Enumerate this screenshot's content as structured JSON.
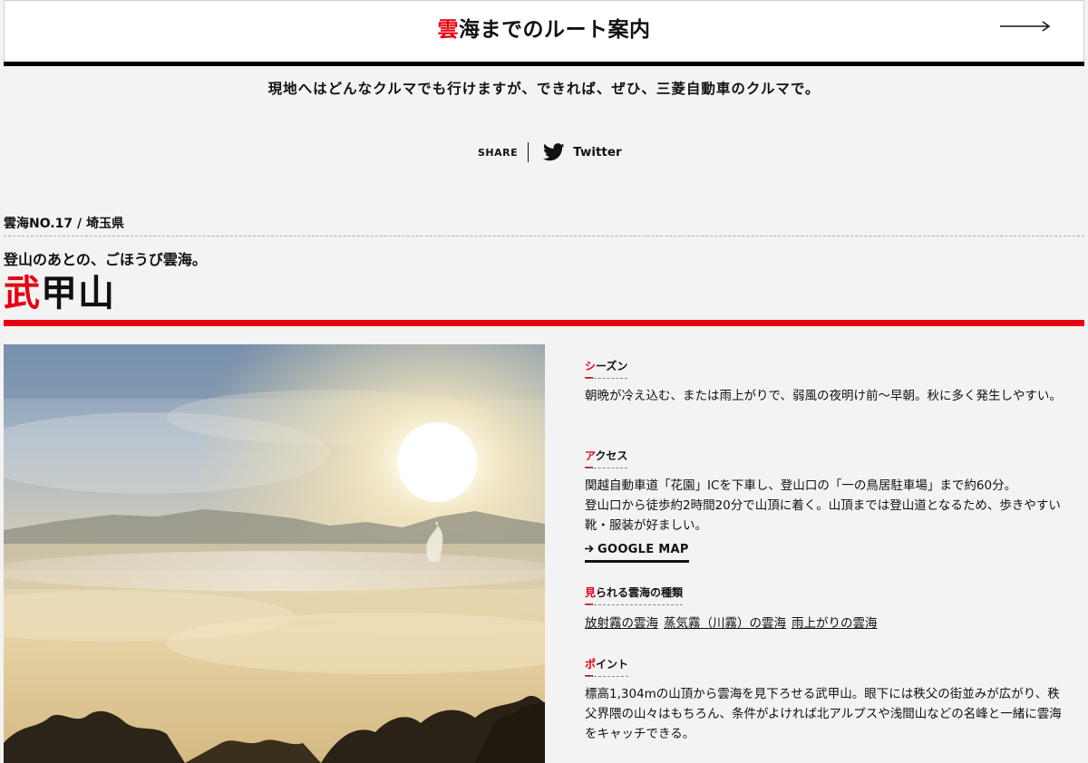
{
  "route_banner": {
    "title_first_char": "雲",
    "title_rest": "海までのルート案内"
  },
  "lead_text": "現地へはどんなクルマでも行けますが、できれば、ぜひ、三菱自動車のクルマで。",
  "share": {
    "label": "SHARE",
    "twitter_label": "Twitter"
  },
  "spot": {
    "number": "雲海NO.17 / 埼玉県",
    "catchcopy": "登山のあとの、ごほうび雲海。",
    "name_first_char": "武",
    "name_rest": "甲山"
  },
  "info": {
    "season": {
      "heading_first": "シ",
      "heading_rest": "ーズン",
      "text": "朝晩が冷え込む、または雨上がりで、弱風の夜明け前～早朝。秋に多く発生しやすい。"
    },
    "access": {
      "heading_first": "ア",
      "heading_rest": "クセス",
      "line1": "関越自動車道「花園」ICを下車し、登山口の「一の鳥居駐車場」まで約60分。",
      "line2": "登山口から徒歩約2時間20分で山頂に着く。山頂までは登山道となるため、歩きやすい靴・服装が好ましい。",
      "map_link": "GOOGLE MAP"
    },
    "types": {
      "heading_first": "見",
      "heading_rest": "られる雲海の種類",
      "tags": [
        "放射霧の雲海",
        "蒸気霧（川霧）の雲海",
        "雨上がりの雲海"
      ]
    },
    "point": {
      "heading_first": "ポ",
      "heading_rest": "イント",
      "text": "標高1,304mの山頂から雲海を見下ろせる武甲山。眼下には秩父の街並みが広がり、秩父界隈の山々はもちろん、条件がよければ北アルプスや浅間山などの名峰と一緒に雲海をキャッチできる。"
    }
  },
  "colors": {
    "accent": "#e60012",
    "background": "#f3f3f3",
    "text": "#111111"
  },
  "icons": [
    "arrow-right-icon",
    "twitter-bird-icon",
    "arrow-right-small-icon"
  ]
}
